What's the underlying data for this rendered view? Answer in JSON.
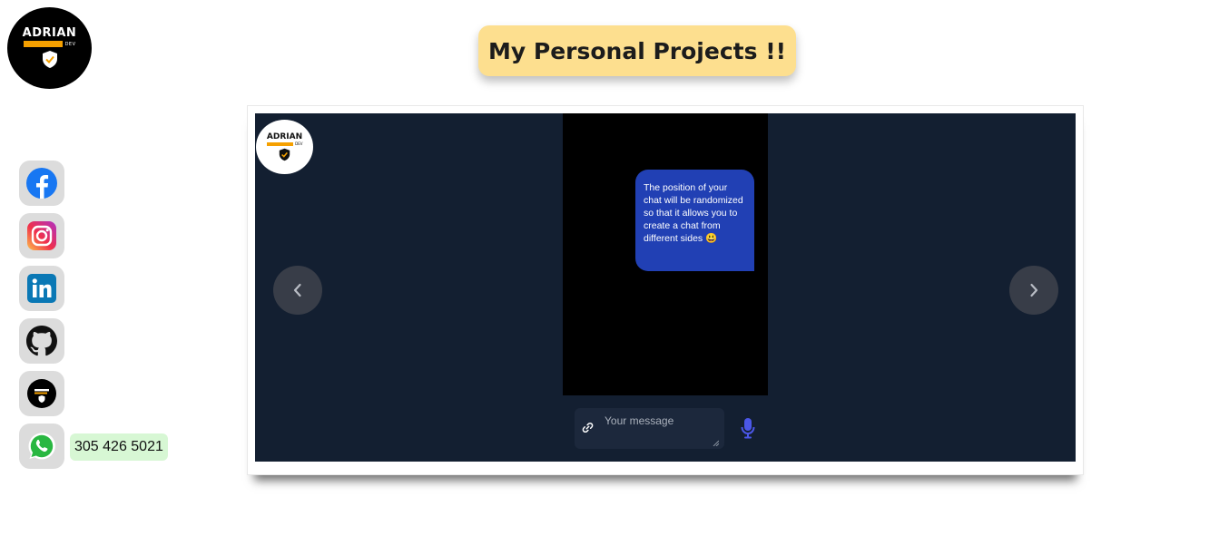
{
  "logo": {
    "word": "ADRIAN",
    "sub": "DEV",
    "icon": "shield-check-icon"
  },
  "page": {
    "title": "My Personal Projects !!"
  },
  "social": [
    {
      "name": "facebook",
      "icon": "facebook-icon"
    },
    {
      "name": "instagram",
      "icon": "instagram-icon"
    },
    {
      "name": "linkedin",
      "icon": "linkedin-icon"
    },
    {
      "name": "github",
      "icon": "github-icon"
    },
    {
      "name": "adrian-dev",
      "icon": "adrian-dev-logo-icon"
    },
    {
      "name": "whatsapp",
      "icon": "whatsapp-icon",
      "phone": "305 426 5021"
    }
  ],
  "carousel": {
    "slide": {
      "logo_word": "ADRIAN",
      "logo_sub": "DEV",
      "bubble_text": "The position of your chat will be randomized so that it allows you to create a chat from different sides 😃",
      "message_placeholder": "Your message"
    },
    "prev_icon": "chevron-left-icon",
    "next_icon": "chevron-right-icon"
  },
  "colors": {
    "title_bg": "#fddf8f",
    "slide_bg": "#131f31",
    "bubble_bg": "#2140b4",
    "phone_chip_bg": "#d7f7d4",
    "logo_accent": "#f5a000"
  }
}
